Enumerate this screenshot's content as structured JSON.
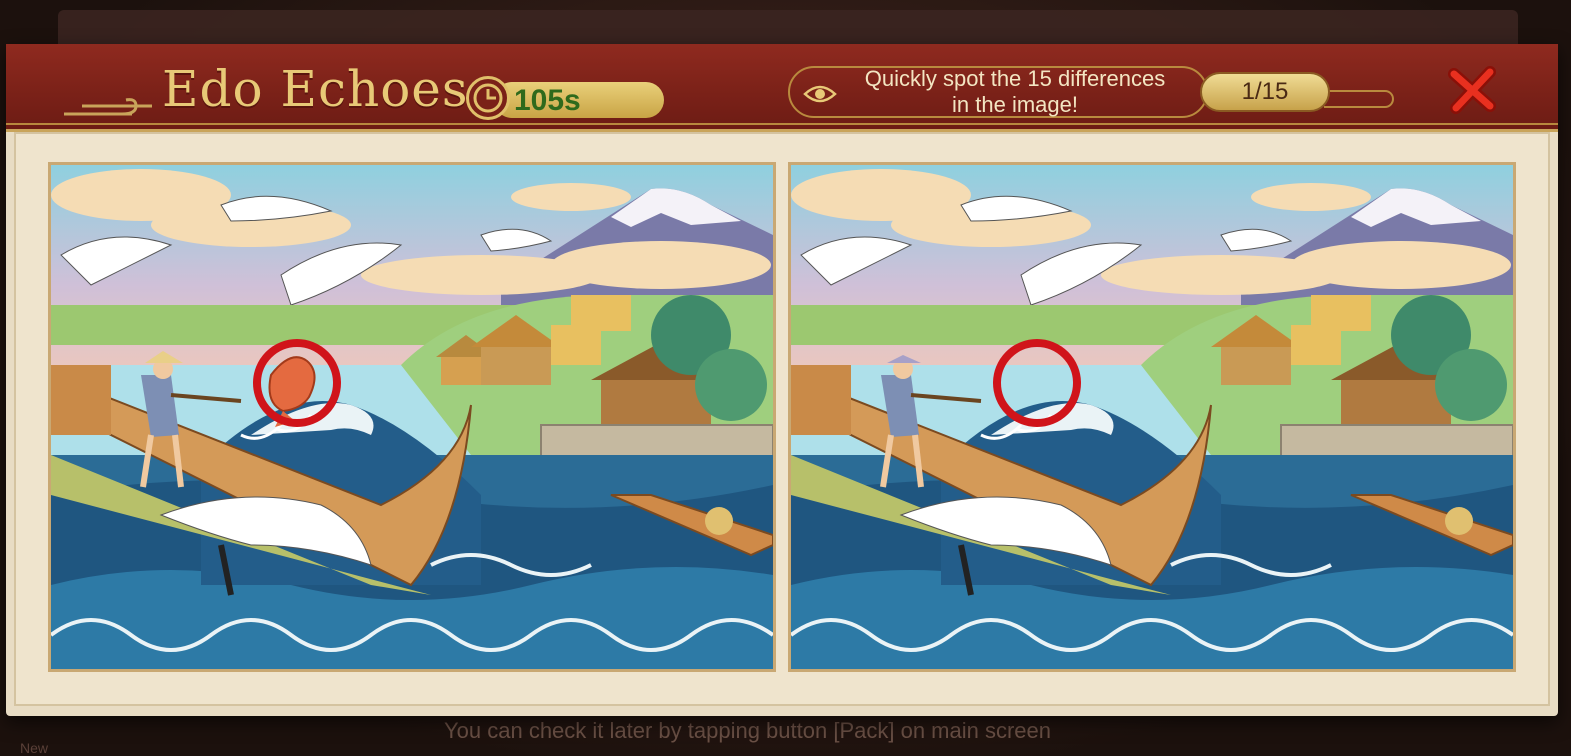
{
  "game": {
    "title": "Edo Echoes",
    "timer": "105s",
    "hint_text_line1": "Quickly spot the 15 differences",
    "hint_text_line2": "in the image!",
    "progress": "1/15",
    "found_count": 1,
    "total_differences": 15
  },
  "footer": {
    "hint": "You can check it later by tapping button [Pack] on main screen",
    "left_label": "New"
  },
  "icons": {
    "timer": "clock-icon",
    "hint": "eye-icon",
    "close": "close-icon",
    "found_marker": "red-circle-marker"
  },
  "colors": {
    "header_red": "#7a2118",
    "gold": "#e8c977",
    "paper": "#e8dcc4",
    "close_red": "#e02a1a",
    "timer_green": "#2f6a1c"
  },
  "images": {
    "left_alt": "Edo-period scene with great wave, fisherman in boat, cranes, village and Mount Fuji",
    "right_alt": "Edo-period scene with great wave, fisherman in boat, cranes, village and Mount Fuji"
  }
}
